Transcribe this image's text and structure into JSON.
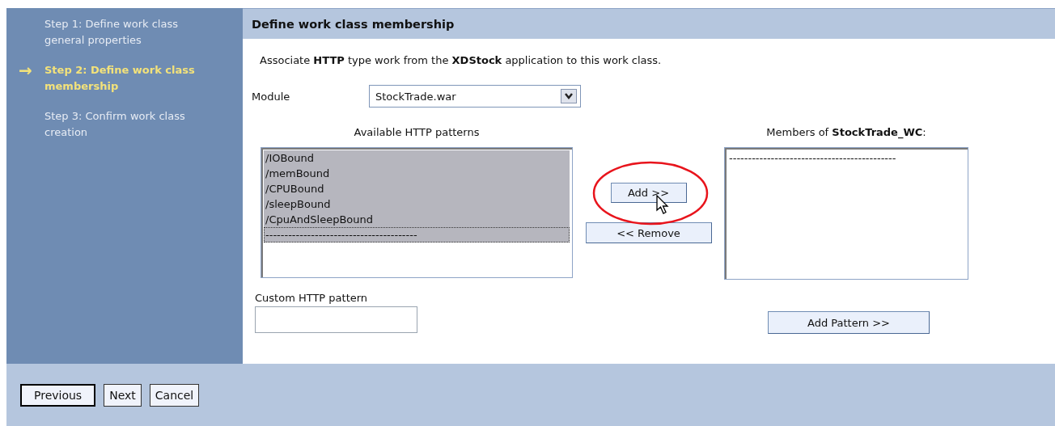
{
  "steps": [
    {
      "label": "Step 1: Define work class general properties",
      "selected": false
    },
    {
      "label": "Step 2: Define work class membership",
      "selected": true
    },
    {
      "label": "Step 3: Confirm work class creation",
      "selected": false
    }
  ],
  "current_marker": "→",
  "panel_title": "Define work class membership",
  "intro": "Associate **HTTP** type work from the **XDStock** application to this work class.",
  "module": {
    "label": "Module",
    "value": "StockTrade.war"
  },
  "available": {
    "heading": "Available HTTP patterns",
    "items": [
      {
        "text": "/IOBound",
        "selected": true
      },
      {
        "text": "/memBound",
        "selected": true
      },
      {
        "text": "/CPUBound",
        "selected": true
      },
      {
        "text": "/sleepBound",
        "selected": true
      },
      {
        "text": "/CpuAndSleepBound",
        "selected": true
      },
      {
        "text": "----------------------------------------",
        "selected": true
      }
    ]
  },
  "add_button": "Add >>",
  "remove_button": "<< Remove",
  "members": {
    "heading": "Members of **StockTrade_WC**:",
    "items": [
      {
        "text": "--------------------------------------------"
      }
    ]
  },
  "custom_pattern": {
    "label": "Custom HTTP pattern"
  },
  "add_pattern_button": "Add Pattern >>",
  "footer_buttons": [
    {
      "label": "Previous",
      "default": true
    },
    {
      "label": "Next",
      "default": false
    },
    {
      "label": "Cancel",
      "default": false
    }
  ]
}
